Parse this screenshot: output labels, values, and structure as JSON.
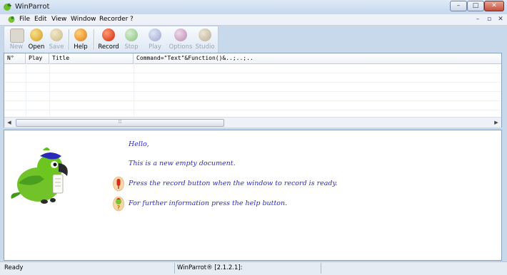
{
  "window": {
    "title": "WinParrot",
    "controls": {
      "minimize": "–",
      "maximize": "□",
      "close": "✕"
    }
  },
  "menubar": {
    "items": [
      "File",
      "Edit",
      "View",
      "Window",
      "Recorder",
      "?"
    ],
    "mdi": {
      "minimize": "–",
      "restore": "▫",
      "close": "✕"
    }
  },
  "toolbar": {
    "buttons": [
      {
        "label": "New",
        "enabled": false,
        "icon": "new-document-icon",
        "color": "#d8d4cc"
      },
      {
        "label": "Open",
        "enabled": true,
        "icon": "open-folder-icon",
        "color": "#e3b53c"
      },
      {
        "label": "Save",
        "enabled": false,
        "icon": "save-disk-icon",
        "color": "#d8c79a"
      },
      {
        "label": "Help",
        "enabled": true,
        "icon": "help-parrot-icon",
        "color": "#f0a020"
      },
      {
        "label": "Record",
        "enabled": true,
        "icon": "record-microphone-icon",
        "color": "#e03a1a"
      },
      {
        "label": "Stop",
        "enabled": false,
        "icon": "stop-icon",
        "color": "#9cc790"
      },
      {
        "label": "Play",
        "enabled": false,
        "icon": "play-icon",
        "color": "#a9b3d8"
      },
      {
        "label": "Options",
        "enabled": false,
        "icon": "options-icon",
        "color": "#c9a4c2"
      },
      {
        "label": "Studio",
        "enabled": false,
        "icon": "studio-icon",
        "color": "#c9c0a8"
      }
    ]
  },
  "list": {
    "columns": [
      "N°",
      "Play",
      "Title",
      "Command=\"Text\"&Function()&..;..;.."
    ],
    "scroll_thumb_glyph": "⦙⦙⦙"
  },
  "document": {
    "lines": [
      "Hello,",
      "This is a new empty document.",
      "Press the record button when the window to record is ready.",
      "For further information press the help button."
    ],
    "text_color": "#2a2ad0"
  },
  "statusbar": {
    "left": "Ready",
    "version": "WinParrot® [2.1.2.1]:"
  }
}
